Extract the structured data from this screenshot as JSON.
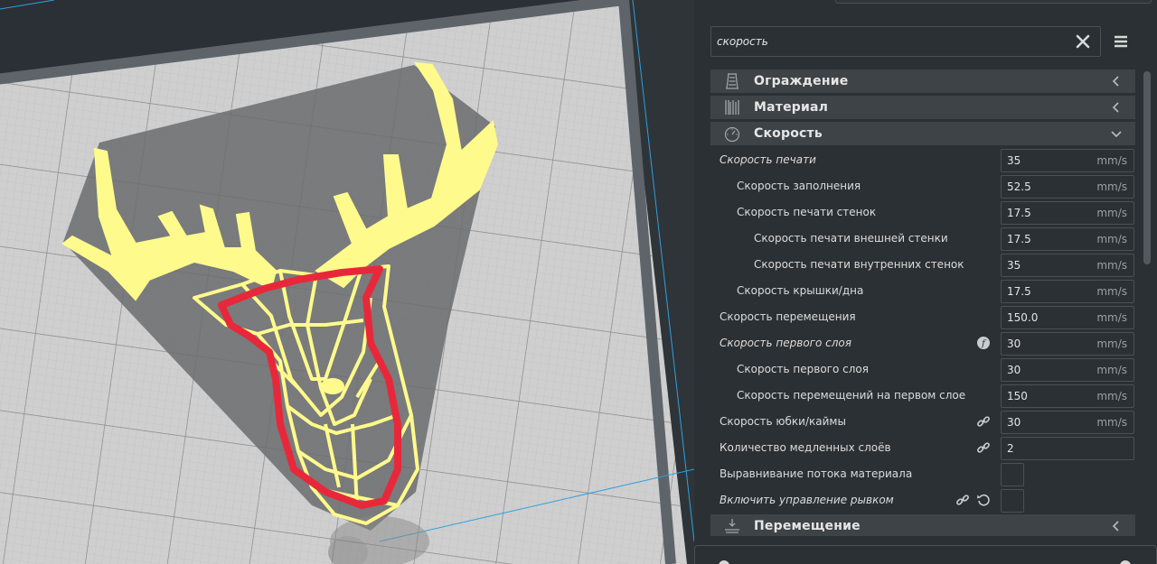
{
  "search": {
    "value": "скорость"
  },
  "categories": {
    "shell": {
      "label": "Ограждение"
    },
    "material": {
      "label": "Материал"
    },
    "speed": {
      "label": "Скорость"
    },
    "travel": {
      "label": "Перемещение"
    }
  },
  "settings": [
    {
      "label": "Скорость печати",
      "value": "35",
      "unit": "mm/s"
    },
    {
      "label": "Скорость заполнения",
      "value": "52.5",
      "unit": "mm/s"
    },
    {
      "label": "Скорость печати стенок",
      "value": "17.5",
      "unit": "mm/s"
    },
    {
      "label": "Скорость печати внешней стенки",
      "value": "17.5",
      "unit": "mm/s"
    },
    {
      "label": "Скорость печати внутренних стенок",
      "value": "35",
      "unit": "mm/s"
    },
    {
      "label": "Скорость крышки/дна",
      "value": "17.5",
      "unit": "mm/s"
    },
    {
      "label": "Скорость перемещения",
      "value": "150.0",
      "unit": "mm/s"
    },
    {
      "label": "Скорость первого слоя",
      "value": "30",
      "unit": "mm/s"
    },
    {
      "label": "Скорость первого слоя",
      "value": "30",
      "unit": "mm/s"
    },
    {
      "label": "Скорость перемещений на первом слое",
      "value": "150",
      "unit": "mm/s"
    },
    {
      "label": "Скорость юбки/каймы",
      "value": "30",
      "unit": "mm/s"
    },
    {
      "label": "Количество медленных слоёв",
      "value": "2",
      "unit": ""
    },
    {
      "label": "Выравнивание потока материала",
      "value": "",
      "unit": ""
    },
    {
      "label": "Включить управление рывком",
      "value": "",
      "unit": ""
    }
  ],
  "colors": {
    "model": "#fffa8c",
    "annotation": "#e8283a",
    "build_plate": "#c8c8c8",
    "panel_bg": "#2b3034",
    "category_bg": "#3d4347",
    "build_volume_edge": "#2fa0e0"
  },
  "icons": {
    "shell": "shell-icon",
    "material": "material-icon",
    "speed": "speedometer-icon",
    "travel": "travel-icon",
    "search_clear": "close-icon",
    "menu": "hamburger-menu-icon",
    "function": "function-icon",
    "link": "link-icon",
    "reset": "reset-icon"
  }
}
